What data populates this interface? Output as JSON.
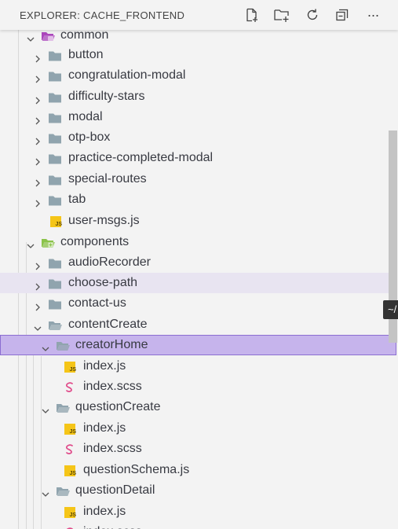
{
  "explorer": {
    "title": "EXPLORER: CACHE_FRONTEND",
    "actions": [
      "new-file-icon",
      "new-folder-icon",
      "refresh-icon",
      "collapse-all-icon",
      "more-icon"
    ],
    "more_glyph": "···"
  },
  "tree": {
    "items": [
      {
        "label": "common",
        "type": "folder-special",
        "open": true
      },
      {
        "label": "button",
        "type": "folder",
        "open": false
      },
      {
        "label": "congratulation-modal",
        "type": "folder",
        "open": false
      },
      {
        "label": "difficulty-stars",
        "type": "folder",
        "open": false
      },
      {
        "label": "modal",
        "type": "folder",
        "open": false
      },
      {
        "label": "otp-box",
        "type": "folder",
        "open": false
      },
      {
        "label": "practice-completed-modal",
        "type": "folder",
        "open": false
      },
      {
        "label": "special-routes",
        "type": "folder",
        "open": false
      },
      {
        "label": "tab",
        "type": "folder",
        "open": false
      },
      {
        "label": "user-msgs.js",
        "type": "js"
      },
      {
        "label": "components",
        "type": "folder-components",
        "open": true
      },
      {
        "label": "audioRecorder",
        "type": "folder",
        "open": false
      },
      {
        "label": "choose-path",
        "type": "folder",
        "open": false,
        "state": "hover"
      },
      {
        "label": "contact-us",
        "type": "folder",
        "open": false
      },
      {
        "label": "contentCreate",
        "type": "folder",
        "open": true
      },
      {
        "label": "creatorHome",
        "type": "folder",
        "open": true,
        "state": "selected"
      },
      {
        "label": "index.js",
        "type": "js"
      },
      {
        "label": "index.scss",
        "type": "scss"
      },
      {
        "label": "questionCreate",
        "type": "folder",
        "open": true
      },
      {
        "label": "index.js",
        "type": "js"
      },
      {
        "label": "index.scss",
        "type": "scss"
      },
      {
        "label": "questionSchema.js",
        "type": "js"
      },
      {
        "label": "questionDetail",
        "type": "folder",
        "open": true
      },
      {
        "label": "index.js",
        "type": "js"
      },
      {
        "label": "index.scss",
        "type": "scss"
      }
    ]
  },
  "tooltip_text": "~/",
  "colors": {
    "selected_bg": "#c6b4ec",
    "hover_bg": "#e8e4f1",
    "folder": "#90a4ae",
    "special_folder": "#ab47bc",
    "components_folder": "#8bc34a",
    "js_icon": "#f5c518",
    "scss_icon": "#e04b8a"
  }
}
